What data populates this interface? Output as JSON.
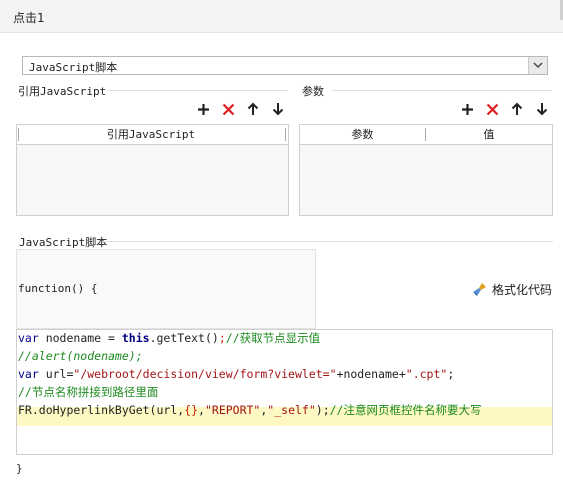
{
  "window": {
    "title": "点击1"
  },
  "script_type": {
    "selected": "JavaScript脚本"
  },
  "ref_js": {
    "group_label": "引用JavaScript",
    "column": "引用JavaScript"
  },
  "params": {
    "group_label": "参数",
    "columns": [
      "参数",
      "值"
    ]
  },
  "script": {
    "group_label": "JavaScript脚本",
    "header": "function() {",
    "footer": "}",
    "format_button": "格式化代码",
    "lines": [
      [
        [
          "kw",
          "var"
        ],
        [
          "pl",
          " nodename = "
        ],
        [
          "kwb",
          "this"
        ],
        [
          "pl",
          ".getText()"
        ],
        [
          "brace",
          ";"
        ],
        [
          "cmt",
          "//获取节点显示值"
        ]
      ],
      [
        [
          "cmti",
          "//alert(nodename);"
        ]
      ],
      [
        [
          "kw",
          "var"
        ],
        [
          "pl",
          " url="
        ],
        [
          "str",
          "\"/webroot/decision/view/form?viewlet=\""
        ],
        [
          "pl",
          "+nodename+"
        ],
        [
          "str",
          "\".cpt\""
        ],
        [
          "pl",
          ";"
        ]
      ],
      [
        [
          "cmt",
          "//节点名称拼接到路径里面"
        ]
      ],
      [
        [
          "pl",
          "FR.doHyperlinkByGet(url,"
        ],
        [
          "brace",
          "{}"
        ],
        [
          "pl",
          ","
        ],
        [
          "str",
          "\"REPORT\""
        ],
        [
          "pl",
          ","
        ],
        [
          "str",
          "\"_self\""
        ],
        [
          "pl",
          ");"
        ],
        [
          "cmt",
          "//注意网页框控件名称要大写"
        ]
      ]
    ]
  },
  "colors": {
    "accent_add": "#222222",
    "delete": "#e02020",
    "highlight_line": "#fdf8c4"
  },
  "icons": [
    "plus-icon",
    "delete-x-icon",
    "arrow-up-icon",
    "arrow-down-icon",
    "broom-icon",
    "chevron-down-icon"
  ]
}
